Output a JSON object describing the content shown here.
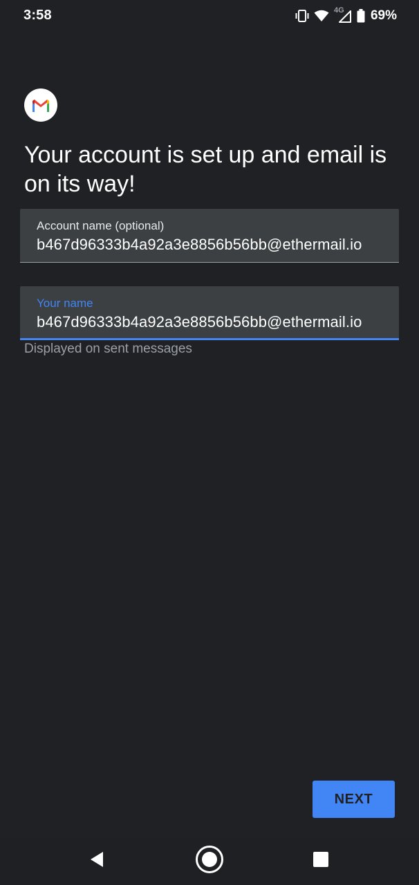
{
  "status_bar": {
    "time": "3:58",
    "network_label": "4G",
    "battery_percent": "69%",
    "icons": [
      "vibrate-icon",
      "wifi-icon",
      "cellular-signal-icon",
      "battery-icon"
    ]
  },
  "header": {
    "logo": "gmail-logo-icon",
    "title": "Your account is set up and email is on its way!"
  },
  "form": {
    "account_name": {
      "label": "Account name (optional)",
      "value": "b467d96333b4a92a3e8856b56bb@ethermail.io"
    },
    "your_name": {
      "label": "Your name",
      "value": "b467d96333b4a92a3e8856b56bb@ethermail.io",
      "helper": "Displayed on sent messages",
      "focused": true
    }
  },
  "actions": {
    "next_label": "NEXT"
  },
  "nav_bar": {
    "icons": [
      "back-icon",
      "home-icon",
      "recents-icon"
    ]
  },
  "colors": {
    "background": "#202124",
    "field_background": "#3c4043",
    "accent": "#4285f4",
    "text_primary": "#ffffff",
    "text_secondary": "#9aa0a6"
  }
}
